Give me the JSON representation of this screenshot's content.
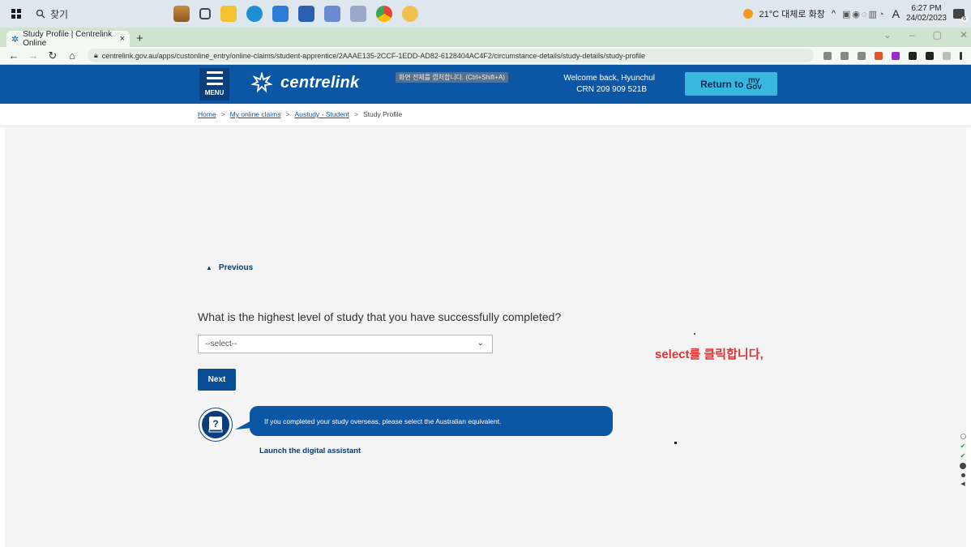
{
  "taskbar": {
    "search_label": "찾기",
    "weather": "21°C 대체로 화창",
    "tray_text": "A",
    "time": "6:27 PM",
    "date": "24/02/2023",
    "notification_badge": "6"
  },
  "browser": {
    "tab_title": "Study Profile | Centrelink Online",
    "tab_close": "×",
    "new_tab": "+",
    "url": "centrelink.gov.au/apps/custonline_entry/online-claims/student-apprentice/2AAAE135-2CCF-1EDD-AD82-6128404AC4F2/circumstance-details/study-details/study-profile"
  },
  "header": {
    "menu_label": "MENU",
    "logo_text": "centrelink",
    "capture_hint": "화면 전체를 캡처합니다. (Ctrl+Shift+A)",
    "welcome": "Welcome back, Hyunchul",
    "crn": "CRN 209 909 521B",
    "return_label": "Return to",
    "mygov_top": "my",
    "mygov_bottom": "Gov"
  },
  "breadcrumb": {
    "items": [
      "Home",
      "My online claims",
      "Austudy - Student",
      "Study Profile"
    ],
    "separator": ">"
  },
  "main": {
    "previous_label": "Previous",
    "question": "What is the highest level of study that you have successfully completed?",
    "select_value": "--select--",
    "next_label": "Next",
    "assistant_text": "If you completed your study overseas, please select the Australian equivalent.",
    "assistant_link": "Launch the digital assistant",
    "annotation_note": "select를 클릭합니다,"
  },
  "colors": {
    "header_blue": "#0b57a6",
    "mygov_cyan": "#38b8de",
    "annotation_red": "#e53030",
    "progress_check": "#1f9a3a"
  }
}
